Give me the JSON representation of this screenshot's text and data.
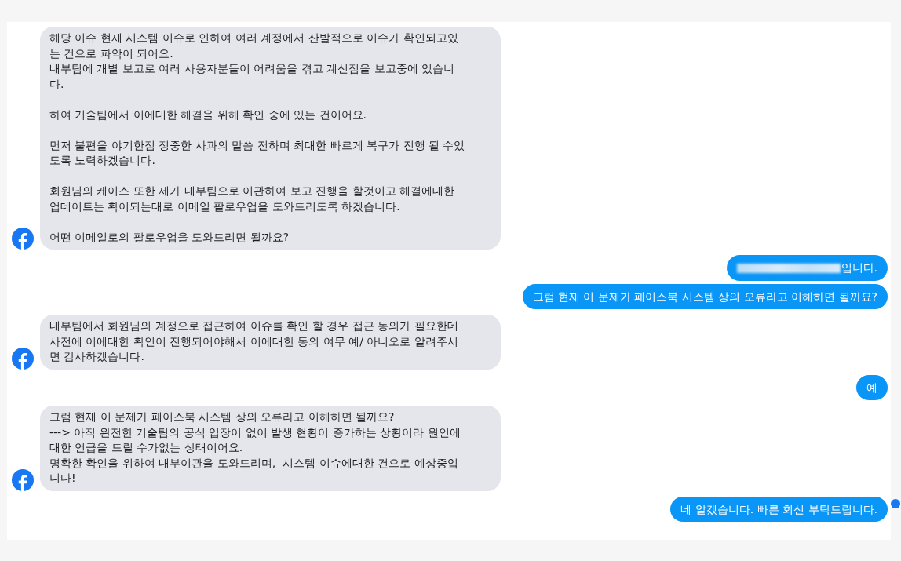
{
  "messages": [
    {
      "kind": "page",
      "redacted": false,
      "text": "해당 이슈 현재 시스템 이슈로 인하여 여러 계정에서 산발적으로 이슈가 확인되고있\n는 건으로 파악이 되어요.\n내부팀에 개별 보고로 여러 사용자분들이 어려움을 겪고 계신점을 보고중에 있습니\n다.\n\n하여 기술팀에서 이에대한 해결을 위해 확인 중에 있는 건이어요.\n\n먼저 불편을 야기한점 정중한 사과의 말씀 전하며 최대한 빠르게 복구가 진행 될 수있\n도록 노력하겠습니다.\n\n회원님의 케이스 또한 제가 내부팀으로 이관하여 보고 진행을 할것이고 해결에대한\n업데이트는 확이되는대로 이메일 팔로우업을 도와드리도록 하겠습니다.\n\n어떤 이메일로의 팔로우업을 도와드리면 될까요?"
    },
    {
      "kind": "user",
      "redacted": true,
      "text": "입니다."
    },
    {
      "kind": "user",
      "redacted": false,
      "text": "그럼 현재 이 문제가 페이스북 시스템 상의 오류라고 이해하면 될까요?"
    },
    {
      "kind": "page",
      "redacted": false,
      "text": "내부팀에서 회원님의 계정으로 접근하여 이슈를 확인 할 경우 접근 동의가 필요한데\n사전에 이에대한 확인이 진행되어야해서 이에대한 동의 여무 예/ 아니오로 알려주시\n면 감사하겠습니다."
    },
    {
      "kind": "user",
      "redacted": false,
      "text": "예"
    },
    {
      "kind": "page",
      "redacted": false,
      "text": "그럼 현재 이 문제가 페이스북 시스템 상의 오류라고 이해하면 될까요?\n---> 아직 완전한 기술팀의 공식 입장이 없이 발생 현황이 증가하는 상황이라 원인에\n대한 언급을 드릴 수가없는 상태이어요.\n명확한 확인을 위하여 내부이관을 도와드리며,  시스템 이슈에대한 건으로 예상중입\n니다!"
    },
    {
      "kind": "user",
      "redacted": false,
      "text": "네 알겠습니다. 빠른 회신 부탁드립니다."
    }
  ]
}
